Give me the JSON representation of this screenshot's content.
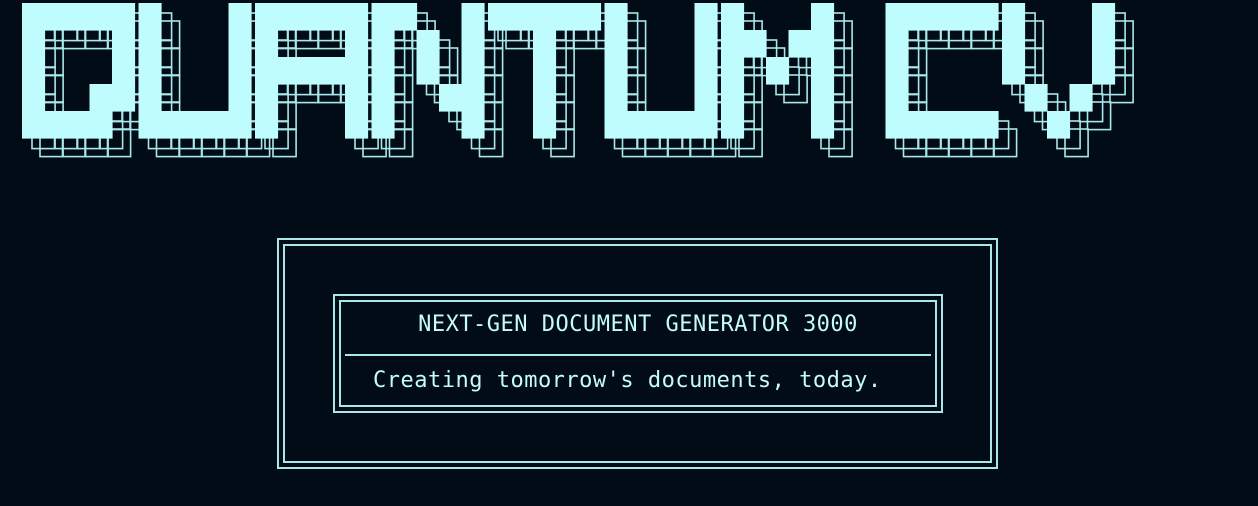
{
  "banner": {
    "text": "QUANTUM CV"
  },
  "panel": {
    "title": "NEXT-GEN DOCUMENT GENERATOR 3000",
    "tagline": "Creating tomorrow's documents, today."
  },
  "colors": {
    "background": "#020c17",
    "accent": "#bffcfd",
    "frame": "#a9e8ea"
  }
}
